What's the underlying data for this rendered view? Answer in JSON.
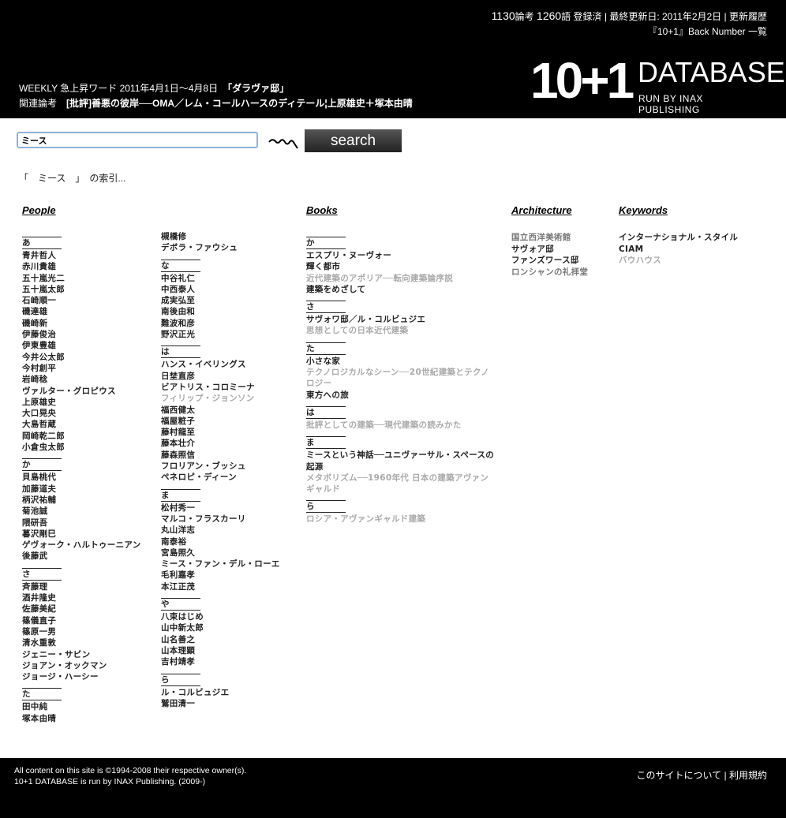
{
  "header": {
    "papers_count": "1130",
    "papers_label": "論考",
    "terms_count": "1260",
    "terms_label": "語 登録済",
    "separator": "|",
    "last_updated": "最終更新日: 2011年2月2日",
    "history_link": "更新履歴",
    "back_number_link": "『10+1』Back Number 一覧",
    "weekly_label": "WEEKLY 急上昇ワード 2011年4月1日〜4月8日",
    "weekly_word": "「ダラヴァ邸」",
    "related_label": "関連論考",
    "related_article": "[批評]善悪の彼岸──OMA／レム・コールハースのディテール¦上原雄史＋塚本由晴",
    "logo_num": "10+1",
    "logo_db": "DATABASE",
    "logo_run": "RUN BY INAX PUBLISHING"
  },
  "search": {
    "value": "ミース",
    "button": "search"
  },
  "index_line": "「　ミース　」　の索引...",
  "people": {
    "title": "People",
    "col1": [
      {
        "kana": "あ",
        "items": [
          {
            "t": "青井哲人"
          },
          {
            "t": "赤川貴雄"
          },
          {
            "t": "五十嵐光二"
          },
          {
            "t": "五十嵐太郎"
          },
          {
            "t": "石崎順一"
          },
          {
            "t": "磯達雄"
          },
          {
            "t": "磯崎新"
          },
          {
            "t": "伊藤俊治"
          },
          {
            "t": "伊東豊雄"
          },
          {
            "t": "今井公太郎"
          },
          {
            "t": "今村創平"
          },
          {
            "t": "岩崎稔"
          },
          {
            "t": "ヴァルター・グロピウス"
          },
          {
            "t": "上原雄史"
          },
          {
            "t": "大口晃央"
          },
          {
            "t": "大島哲蔵"
          },
          {
            "t": "岡崎乾二郎"
          },
          {
            "t": "小倉虫太郎"
          }
        ]
      },
      {
        "kana": "か",
        "items": [
          {
            "t": "貝島桃代"
          },
          {
            "t": "加藤道夫"
          },
          {
            "t": "柄沢祐輔"
          },
          {
            "t": "菊池誠"
          },
          {
            "t": "隈研吾"
          },
          {
            "t": "暮沢剛巳"
          },
          {
            "t": "ゲヴォーク・ハルトゥーニアン"
          },
          {
            "t": "後藤武"
          }
        ]
      },
      {
        "kana": "さ",
        "items": [
          {
            "t": "斉藤理"
          },
          {
            "t": "酒井隆史"
          },
          {
            "t": "佐藤美紀"
          },
          {
            "t": "篠儀直子"
          },
          {
            "t": "篠原一男"
          },
          {
            "t": "清水重敦"
          },
          {
            "t": "ジェニー・サビン"
          },
          {
            "t": "ジョアン・オックマン"
          },
          {
            "t": "ジョージ・ハーシー"
          }
        ]
      },
      {
        "kana": "た",
        "items": [
          {
            "t": "田中純"
          },
          {
            "t": "塚本由晴"
          }
        ]
      }
    ],
    "col2_lead": [
      {
        "t": "槻橋修"
      },
      {
        "t": "デボラ・ファウシュ"
      }
    ],
    "col2": [
      {
        "kana": "な",
        "items": [
          {
            "t": "中谷礼仁"
          },
          {
            "t": "中西泰人"
          },
          {
            "t": "成実弘至"
          },
          {
            "t": "南後由和"
          },
          {
            "t": "難波和彦"
          },
          {
            "t": "野沢正光"
          }
        ]
      },
      {
        "kana": "は",
        "items": [
          {
            "t": "ハンス・イベリングス"
          },
          {
            "t": "日埜直彦"
          },
          {
            "t": "ビアトリス・コロミーナ"
          },
          {
            "t": "フィリップ・ジョンソン",
            "muted": true
          },
          {
            "t": "福西健太"
          },
          {
            "t": "福屋粧子"
          },
          {
            "t": "藤村龍至"
          },
          {
            "t": "藤本壮介"
          },
          {
            "t": "藤森照信"
          },
          {
            "t": "フロリアン・ブッシュ"
          },
          {
            "t": "ペネロピ・ディーン"
          }
        ]
      },
      {
        "kana": "ま",
        "items": [
          {
            "t": "松村秀一"
          },
          {
            "t": "マルコ・フラスカーリ"
          },
          {
            "t": "丸山洋志"
          },
          {
            "t": "南泰裕"
          },
          {
            "t": "宮島照久"
          },
          {
            "t": "ミース・ファン・デル・ローエ"
          },
          {
            "t": "毛利嘉孝"
          },
          {
            "t": "本江正茂"
          }
        ]
      },
      {
        "kana": "や",
        "items": [
          {
            "t": "八束はじめ"
          },
          {
            "t": "山中新太郎"
          },
          {
            "t": "山名善之"
          },
          {
            "t": "山本理顕"
          },
          {
            "t": "吉村靖孝"
          }
        ]
      },
      {
        "kana": "ら",
        "items": [
          {
            "t": "ル・コルビュジエ"
          },
          {
            "t": "鷲田清一"
          }
        ]
      }
    ]
  },
  "books": {
    "title": "Books",
    "groups": [
      {
        "kana": "か",
        "items": [
          {
            "t": "エスプリ・ヌーヴォー"
          },
          {
            "t": "輝く都市"
          },
          {
            "t": "近代建築のアポリア──転向建築論序説",
            "muted": true
          },
          {
            "t": "建築をめざして"
          }
        ]
      },
      {
        "kana": "さ",
        "items": [
          {
            "t": "サヴォワ邸／ル・コルビュジエ"
          },
          {
            "t": "思想としての日本近代建築",
            "muted": true
          }
        ]
      },
      {
        "kana": "た",
        "items": [
          {
            "t": "小さな家"
          },
          {
            "t": "テクノロジカルなシーン──20世紀建築とテクノロジー",
            "muted": true
          },
          {
            "t": "東方への旅"
          }
        ]
      },
      {
        "kana": "は",
        "items": [
          {
            "t": "批評としての建築──現代建築の読みかた",
            "muted": true
          }
        ]
      },
      {
        "kana": "ま",
        "items": [
          {
            "t": "ミースという神話──ユニヴァーサル・スペースの起源"
          },
          {
            "t": "メタボリズム──1960年代 日本の建築アヴァンギャルド",
            "muted": true
          }
        ]
      },
      {
        "kana": "ら",
        "items": [
          {
            "t": "ロシア・アヴァンギャルド建築",
            "muted": true
          }
        ]
      }
    ]
  },
  "architecture": {
    "title": "Architecture",
    "items": [
      {
        "t": "国立西洋美術館",
        "mid": true
      },
      {
        "t": "サヴォア邸"
      },
      {
        "t": "ファンズワース邸"
      },
      {
        "t": "ロンシャンの礼拝堂",
        "mid": true
      }
    ]
  },
  "keywords": {
    "title": "Keywords",
    "items": [
      {
        "t": "インターナショナル・スタイル"
      },
      {
        "t": "CIAM"
      },
      {
        "t": "バウハウス",
        "muted": true
      }
    ]
  },
  "footer": {
    "copyright": "All content on this site is ©1994-2008 their respective owner(s).",
    "run_by": "10+1 DATABASE is run by INAX Publishing. (2009-)",
    "about": "このサイトについて",
    "sep": "|",
    "terms": "利用規約"
  }
}
